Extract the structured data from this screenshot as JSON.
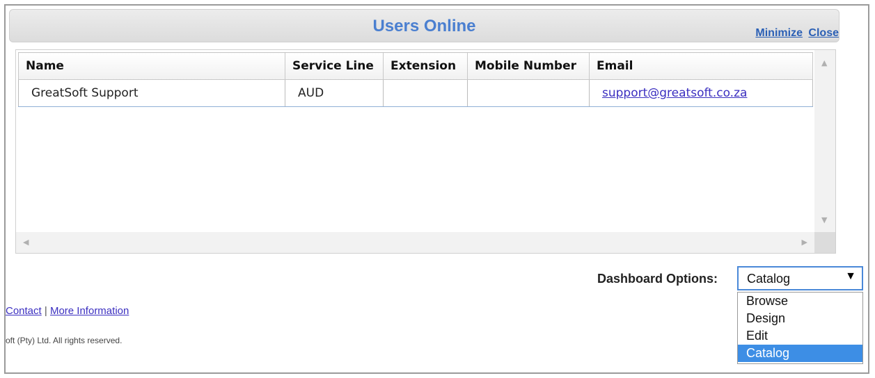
{
  "panel": {
    "title": "Users Online",
    "minimize_label": "Minimize",
    "close_label": "Close"
  },
  "table": {
    "columns": [
      "Name",
      "Service Line",
      "Extension",
      "Mobile Number",
      "Email"
    ],
    "rows": [
      {
        "name": "GreatSoft Support",
        "service_line": "AUD",
        "extension": "",
        "mobile": "",
        "email": "support@greatsoft.co.za"
      }
    ]
  },
  "dashboard": {
    "label": "Dashboard Options:",
    "selected": "Catalog",
    "options": [
      "Browse",
      "Design",
      "Edit",
      "Catalog"
    ]
  },
  "footer": {
    "contact_label": "Contact",
    "separator": "|",
    "more_info_label": "More Information",
    "copyright": "oft (Pty) Ltd. All rights reserved."
  },
  "colors": {
    "title": "#4a7fd0",
    "selected_option": "#3d8ee5",
    "link": "#3b2fc0"
  }
}
